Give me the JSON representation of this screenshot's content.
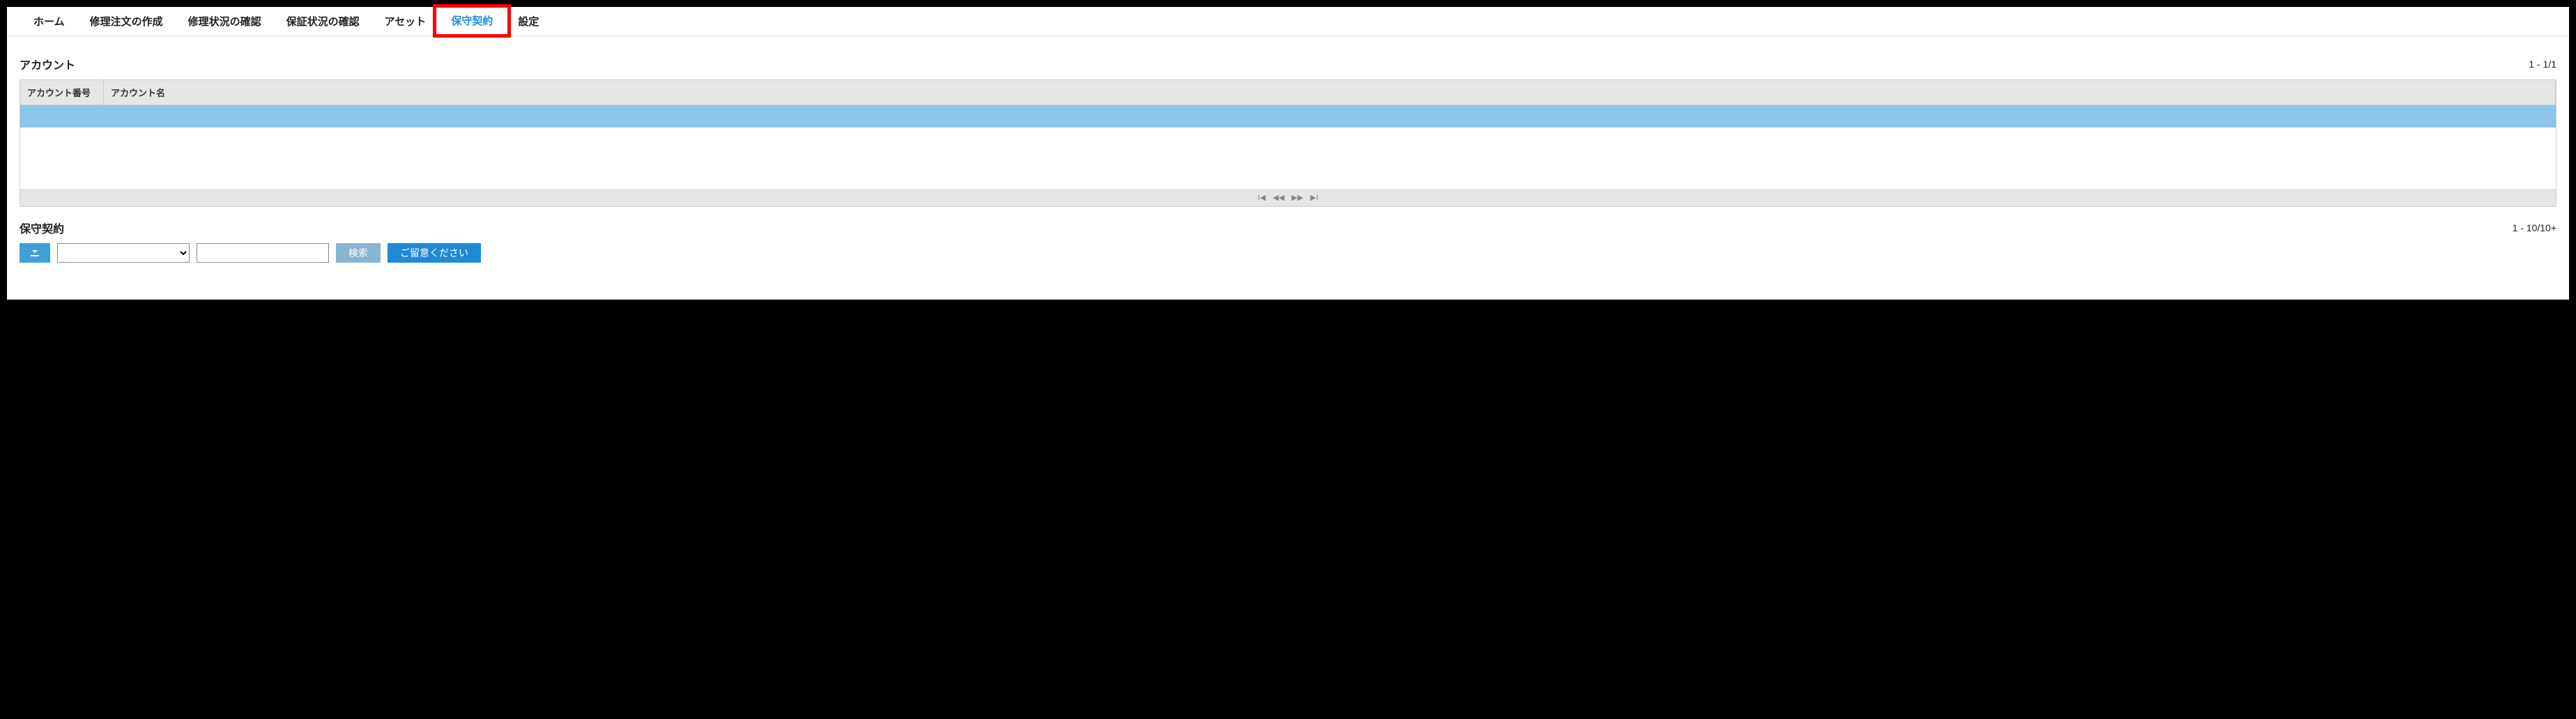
{
  "nav": {
    "items": [
      {
        "label": "ホーム"
      },
      {
        "label": "修理注文の作成"
      },
      {
        "label": "修理状況の確認"
      },
      {
        "label": "保証状況の確認"
      },
      {
        "label": "アセット"
      },
      {
        "label": "保守契約"
      },
      {
        "label": "設定"
      }
    ],
    "active_index": 5,
    "highlight_index": 5
  },
  "account_section": {
    "title": "アカウント",
    "page_range": "1 - 1/1",
    "columns": [
      {
        "label": "アカウント番号"
      },
      {
        "label": "アカウント名"
      }
    ],
    "rows": [
      {
        "num": "",
        "name": ""
      }
    ],
    "pager": {
      "first": "⏮",
      "prev": "◀◀",
      "next": "▶▶",
      "last": "⏭"
    }
  },
  "contract_section": {
    "title": "保守契約",
    "page_range": "1 - 10/10+",
    "toolbar": {
      "download_icon": "download-icon",
      "select_value": "",
      "input_value": "",
      "search_label": "検索",
      "note_label": "ご留意ください"
    }
  }
}
